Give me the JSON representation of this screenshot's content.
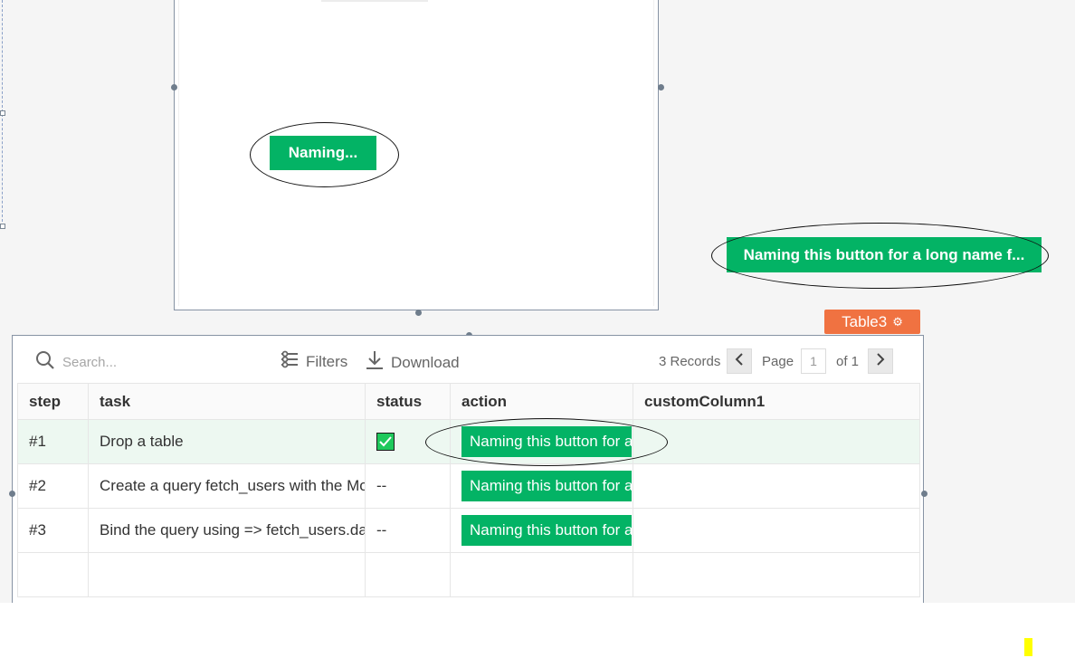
{
  "buttons": {
    "short_label": "Naming...",
    "long_label": "Naming this button for a long name f..."
  },
  "table_widget": {
    "badge_label": "Table3",
    "badge_icon": "gear-icon",
    "badge_color": "#f07241",
    "toolbar": {
      "search_placeholder": "Search...",
      "filters_label": "Filters",
      "download_label": "Download",
      "records_label": "3 Records",
      "page_label": "Page",
      "page_value": "1",
      "of_label": "of 1"
    },
    "columns": [
      "step",
      "task",
      "status",
      "action",
      "customColumn1"
    ],
    "rows": [
      {
        "step": "#1",
        "task": "Drop a table",
        "status": "checked",
        "action": "Naming this button for a long name f",
        "custom": ""
      },
      {
        "step": "#2",
        "task": "Create a query fetch_users with the Mock DB",
        "status": "--",
        "action": "Naming this button for a long name f",
        "custom": ""
      },
      {
        "step": "#3",
        "task": "Bind the query using => fetch_users.data",
        "status": "--",
        "action": "Naming this button for a long name f",
        "custom": ""
      }
    ]
  },
  "colors": {
    "accent_green": "#03b365",
    "canvas_bg": "#f5f5f5",
    "selected_row": "#edf8f1"
  }
}
